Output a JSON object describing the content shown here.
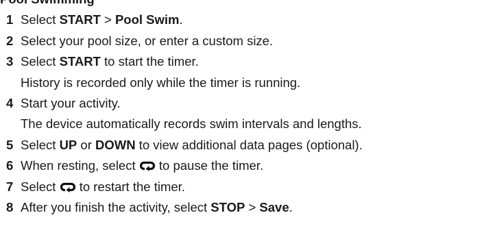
{
  "heading": "Pool Swimming",
  "steps": [
    {
      "number": "1",
      "parts": [
        {
          "text": "Select "
        },
        {
          "text": "START",
          "bold": true
        },
        {
          "text": " > "
        },
        {
          "text": "Pool Swim",
          "bold": true
        },
        {
          "text": "."
        }
      ]
    },
    {
      "number": "2",
      "parts": [
        {
          "text": "Select your pool size, or enter a custom size."
        }
      ]
    },
    {
      "number": "3",
      "parts": [
        {
          "text": "Select "
        },
        {
          "text": "START",
          "bold": true
        },
        {
          "text": " to start the timer."
        }
      ],
      "note": "History is recorded only while the timer is running."
    },
    {
      "number": "4",
      "parts": [
        {
          "text": "Start your activity."
        }
      ],
      "note": "The device automatically records swim intervals and lengths."
    },
    {
      "number": "5",
      "parts": [
        {
          "text": "Select "
        },
        {
          "text": "UP",
          "bold": true
        },
        {
          "text": " or "
        },
        {
          "text": "DOWN",
          "bold": true
        },
        {
          "text": " to view additional data pages (optional)."
        }
      ]
    },
    {
      "number": "6",
      "parts": [
        {
          "text": "When resting, select "
        },
        {
          "icon": "loop-icon"
        },
        {
          "text": " to pause the timer."
        }
      ]
    },
    {
      "number": "7",
      "parts": [
        {
          "text": "Select "
        },
        {
          "icon": "loop-icon"
        },
        {
          "text": " to restart the timer."
        }
      ]
    },
    {
      "number": "8",
      "parts": [
        {
          "text": "After you finish the activity, select "
        },
        {
          "text": "STOP",
          "bold": true
        },
        {
          "text": " > "
        },
        {
          "text": "Save",
          "bold": true
        },
        {
          "text": "."
        }
      ]
    }
  ]
}
